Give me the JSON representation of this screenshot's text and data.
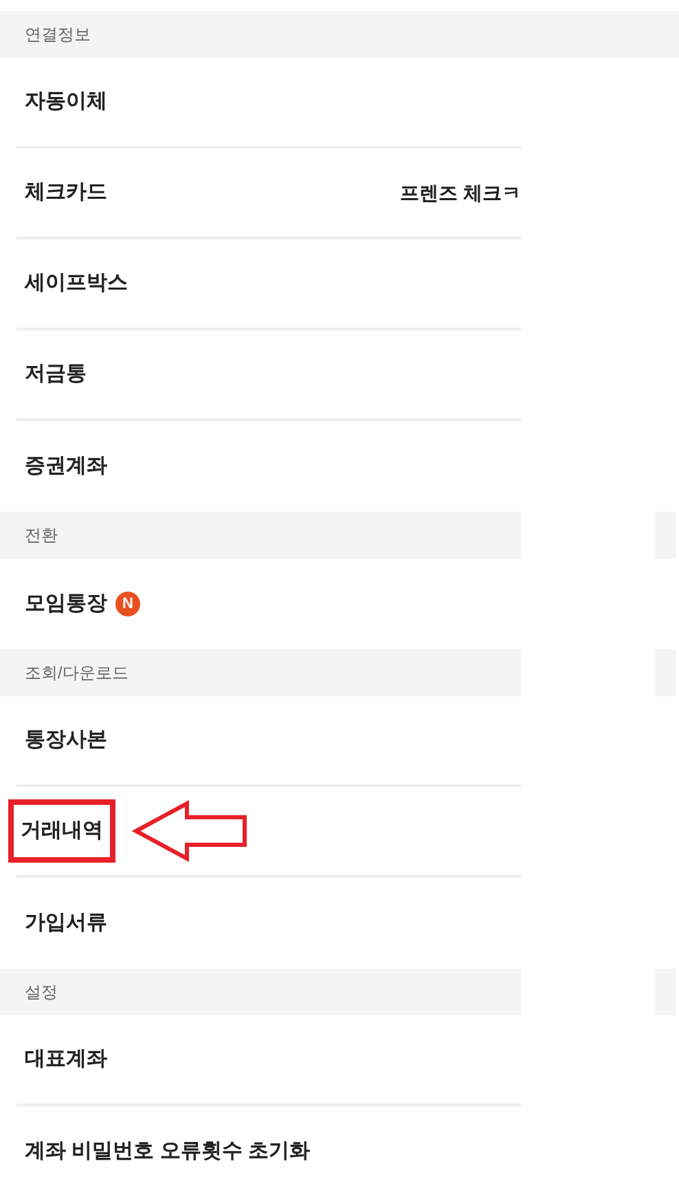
{
  "sections": [
    {
      "title": "연결정보",
      "full_width": true,
      "items": [
        {
          "label": "자동이체",
          "highlighted": false
        },
        {
          "label": "체크카드",
          "value": "프렌즈 체크ㅋ",
          "highlighted": false
        },
        {
          "label": "세이프박스",
          "highlighted": false
        },
        {
          "label": "저금통",
          "highlighted": false
        },
        {
          "label": "증권계좌",
          "highlighted": false
        }
      ]
    },
    {
      "title": "전환",
      "full_width": false,
      "items": [
        {
          "label": "모임통장",
          "badge": "N",
          "highlighted": false
        }
      ]
    },
    {
      "title": "조회/다운로드",
      "full_width": false,
      "items": [
        {
          "label": "통장사본",
          "highlighted": false
        },
        {
          "label": "거래내역",
          "highlighted": true
        },
        {
          "label": "가입서류",
          "highlighted": false
        }
      ]
    },
    {
      "title": "설정",
      "full_width": false,
      "items": [
        {
          "label": "대표계좌",
          "highlighted": false
        },
        {
          "label": "계좌 비밀번호 오류횟수 초기화",
          "highlighted": false
        }
      ]
    }
  ]
}
